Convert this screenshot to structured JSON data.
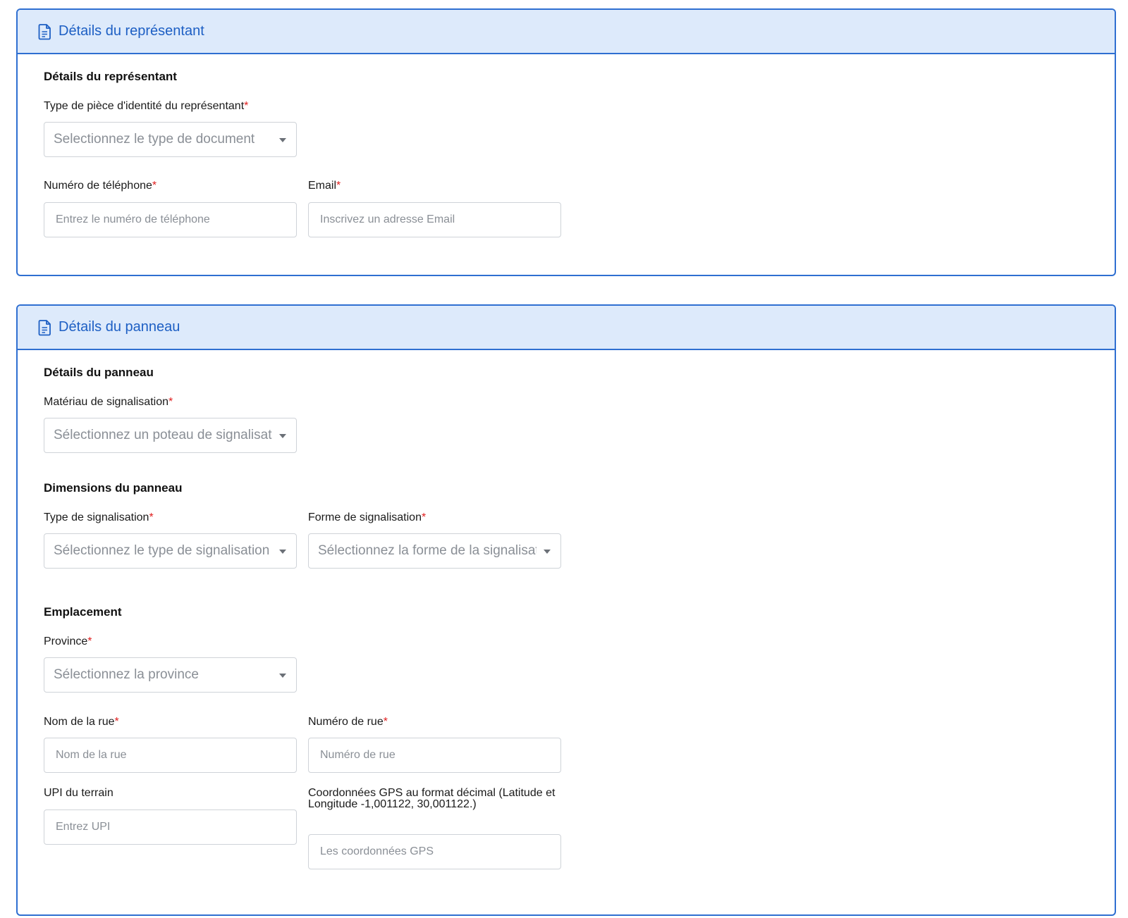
{
  "representative_card": {
    "header_title": "Détails du représentant",
    "section_title": "Détails du représentant",
    "id_type": {
      "label": "Type de pièce d'identité du représentant",
      "required_mark": "*",
      "placeholder": "Selectionnez le type de document"
    },
    "phone": {
      "label": "Numéro de téléphone",
      "required_mark": "*",
      "placeholder": "Entrez le numéro de téléphone"
    },
    "email": {
      "label": "Email",
      "required_mark": "*",
      "placeholder": "Inscrivez un adresse Email"
    }
  },
  "panel_card": {
    "header_title": "Détails du panneau",
    "section_title": "Détails du panneau",
    "material": {
      "label": "Matériau de signalisation",
      "required_mark": "*",
      "placeholder": "Sélectionnez un poteau de signalisation"
    },
    "dimensions_title": "Dimensions du panneau",
    "sign_type": {
      "label": "Type de signalisation",
      "required_mark": "*",
      "placeholder": "Sélectionnez le type de signalisation"
    },
    "sign_shape": {
      "label": "Forme de signalisation",
      "required_mark": "*",
      "placeholder": "Sélectionnez la forme de la signalisation"
    },
    "location_title": "Emplacement",
    "province": {
      "label": "Province",
      "required_mark": "*",
      "placeholder": "Sélectionnez la province"
    },
    "street_name": {
      "label": "Nom de la rue",
      "required_mark": "*",
      "placeholder": "Nom de la rue"
    },
    "street_number": {
      "label": "Numéro de rue",
      "required_mark": "*",
      "placeholder": "Numéro de rue"
    },
    "upi": {
      "label": "UPI du terrain",
      "placeholder": "Entrez UPI"
    },
    "gps": {
      "label": "Coordonnées GPS au format décimal (Latitude et Longitude -1,001122, 30,001122.)",
      "placeholder": "Les coordonnées GPS"
    }
  },
  "colors": {
    "accent": "#2f6fd1",
    "header_bg": "#ddeafb",
    "required": "#e02020"
  }
}
